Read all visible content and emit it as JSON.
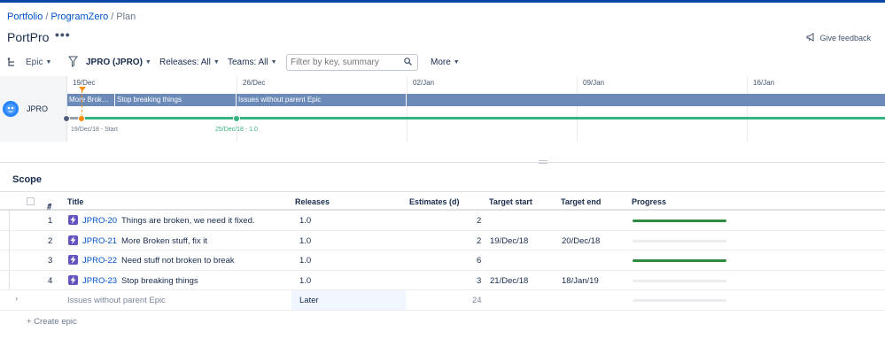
{
  "breadcrumb": {
    "portfolio": "Portfolio",
    "program": "ProgramZero",
    "plan": "Plan"
  },
  "page": {
    "title": "PortPro",
    "more_actions": "•••",
    "feedback_label": "Give feedback"
  },
  "toolbar": {
    "hierarchy": "Epic",
    "project_filter": "JPRO (JPRO)",
    "releases_filter": "Releases: All",
    "teams_filter": "Teams: All",
    "search_placeholder": "Filter by key, summary",
    "more": "More"
  },
  "timeline": {
    "dates": [
      "19/Dec",
      "26/Dec",
      "02/Jan",
      "09/Jan",
      "16/Jan"
    ],
    "project_label": "JPRO",
    "bars": [
      "More Brok…",
      "Stop breaking things",
      "Issues without parent Epic"
    ],
    "release_start_label": "19/Dec/18 - Start",
    "release_label": "25/Dec/18 - 1.0"
  },
  "scope": {
    "title": "Scope",
    "headers": {
      "num": "#",
      "title": "Title",
      "releases": "Releases",
      "estimates": "Estimates (d)",
      "target_start": "Target start",
      "target_end": "Target end",
      "progress": "Progress"
    },
    "rows": [
      {
        "num": "1",
        "key": "JPRO-20",
        "summary": "Things are broken, we need it fixed.",
        "release": "1.0",
        "estimate": "2",
        "start": "",
        "end": "",
        "progress": 1.0
      },
      {
        "num": "2",
        "key": "JPRO-21",
        "summary": "More Broken stuff, fix it",
        "release": "1.0",
        "estimate": "2",
        "start": "19/Dec/18",
        "end": "20/Dec/18",
        "progress": 0.0
      },
      {
        "num": "3",
        "key": "JPRO-22",
        "summary": "Need stuff not broken to break",
        "release": "1.0",
        "estimate": "6",
        "start": "",
        "end": "",
        "progress": 1.0
      },
      {
        "num": "4",
        "key": "JPRO-23",
        "summary": "Stop breaking things",
        "release": "1.0",
        "estimate": "3",
        "start": "21/Dec/18",
        "end": "18/Jan/19",
        "progress": 0.0
      }
    ],
    "no_parent": {
      "title": "Issues without parent Epic",
      "release": "Later",
      "estimate": "24",
      "progress": 0.0
    },
    "create_label": "+ Create epic"
  },
  "colors": {
    "accent": "#0052cc",
    "epic": "#6554c0",
    "bar": "#6b8ab8",
    "release": "#36b37e",
    "progress": "#2e8b3f"
  }
}
